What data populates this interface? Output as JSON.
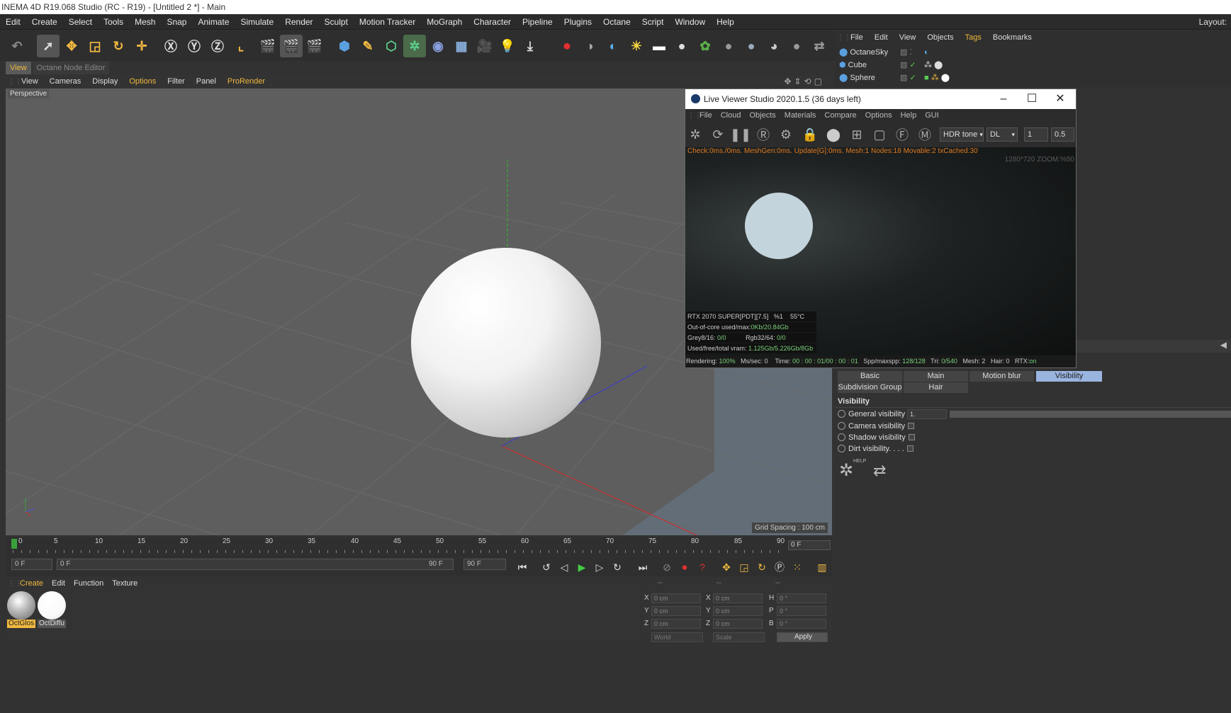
{
  "window_title": "INEMA 4D R19.068 Studio (RC - R19) - [Untitled 2 *] - Main",
  "menubar": {
    "items": [
      "Edit",
      "Create",
      "Select",
      "Tools",
      "Mesh",
      "Snap",
      "Animate",
      "Simulate",
      "Render",
      "Sculpt",
      "Motion Tracker",
      "MoGraph",
      "Character",
      "Pipeline",
      "Plugins",
      "Octane",
      "Script",
      "Window",
      "Help"
    ],
    "layout_label": "Layout:"
  },
  "view_tabs": [
    "View",
    "Octane Node Editor"
  ],
  "viewport_menu": [
    "View",
    "Cameras",
    "Display",
    "Options",
    "Filter",
    "Panel",
    "ProRender"
  ],
  "viewport": {
    "label": "Perspective",
    "grid_spacing": "Grid Spacing : 100 cm"
  },
  "timeline": {
    "ticks": [
      "0",
      "5",
      "10",
      "15",
      "20",
      "25",
      "30",
      "35",
      "40",
      "45",
      "50",
      "55",
      "60",
      "65",
      "70",
      "75",
      "80",
      "85",
      "90"
    ],
    "current_frame": "0 F",
    "start_field": "0 F",
    "range_start": "0 F",
    "range_end": "90 F",
    "end_field": "90 F"
  },
  "material_manager": {
    "menu": [
      "Create",
      "Edit",
      "Function",
      "Texture"
    ],
    "materials": [
      {
        "name": "OctGlos"
      },
      {
        "name": "OctDiffu"
      }
    ]
  },
  "coords": {
    "headers": [
      "--",
      "--",
      "--"
    ],
    "rows": [
      {
        "l1": "X",
        "v1": "0 cm",
        "l2": "X",
        "v2": "0 cm",
        "l3": "H",
        "v3": "0 °"
      },
      {
        "l1": "Y",
        "v1": "0 cm",
        "l2": "Y",
        "v2": "0 cm",
        "l3": "P",
        "v3": "0 °"
      },
      {
        "l1": "Z",
        "v1": "0 cm",
        "l2": "Z",
        "v2": "0 cm",
        "l3": "B",
        "v3": "0 °"
      }
    ],
    "world": "World",
    "scale": "Scale",
    "apply": "Apply"
  },
  "object_manager": {
    "menu": [
      "File",
      "Edit",
      "View",
      "Objects",
      "Tags",
      "Bookmarks"
    ],
    "objects": [
      "OctaneSky",
      "Cube",
      "Sphere"
    ]
  },
  "live_viewer": {
    "title": "Live Viewer Studio 2020.1.5 (36 days left)",
    "menu": [
      "File",
      "Cloud",
      "Objects",
      "Materials",
      "Compare",
      "Options",
      "Help",
      "GUI"
    ],
    "tonemap": "HDR tone",
    "mode": "DL",
    "value1": "1",
    "value2": "0.5",
    "status_line": "Check:0ms./0ms. MeshGen:0ms. Update[G]:0ms. Mesh:1 Nodes:18 Movable:2 txCached:30",
    "resolution": "1280*720 ZOOM:%50",
    "gpu": "RTX 2070 SUPER[PDT][7.5]",
    "gpu_pct": "%1",
    "gpu_temp": "55°C",
    "ooc_label": "Out-of-core used/max:",
    "ooc_value": "0Kb/20.84Gb",
    "grey_label": "Grey8/16:",
    "grey_value": "0/0",
    "rgb_label": "Rgb32/64:",
    "rgb_value": "0/0",
    "vram_label": "Used/free/total vram:",
    "vram_value": "1.125Gb/5.226Gb/8Gb",
    "rendering_label": "Rendering:",
    "rendering_value": "100%",
    "mssec": "Ms/sec: 0",
    "time_label": "Time:",
    "time_value": "00 : 00 : 01/00 : 00 : 01",
    "spp_label": "Spp/maxspp:",
    "spp_value": "128/128",
    "tri_label": "Tri:",
    "tri_value": "0/540",
    "mesh": "Mesh: 2",
    "hair": "Hair: 0",
    "rtx_label": "RTX:",
    "rtx_value": "on"
  },
  "attributes": {
    "tabs": [
      "Basic",
      "Main",
      "Motion blur",
      "Visibility"
    ],
    "tabs2": [
      "Subdivision Group",
      "Hair"
    ],
    "section": "Visibility",
    "rows": [
      {
        "label": "General visibility",
        "value": "1."
      },
      {
        "label": "Camera visibility",
        "checked": false
      },
      {
        "label": "Shadow visibility",
        "checked": false
      },
      {
        "label": "Dirt visibility. . . .",
        "checked": false
      }
    ],
    "help_label": "HELP"
  },
  "colors": {
    "accent": "#f0b840",
    "selected_tab": "#9ab4e0",
    "stat_green": "#7ad07a"
  }
}
